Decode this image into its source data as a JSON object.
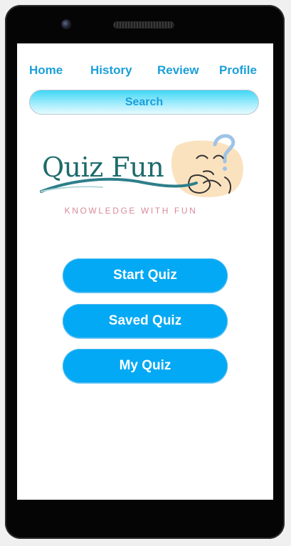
{
  "nav": {
    "items": [
      {
        "label": "Home"
      },
      {
        "label": "History"
      },
      {
        "label": "Review"
      },
      {
        "label": "Profile"
      }
    ]
  },
  "search": {
    "label": "Search"
  },
  "logo": {
    "title": "Quiz Fun",
    "tagline": "KNOWLEDGE WITH FUN"
  },
  "actions": {
    "start_quiz": "Start Quiz",
    "saved_quiz": "Saved Quiz",
    "my_quiz": "My Quiz"
  },
  "colors": {
    "accent": "#03a9f4",
    "nav_text": "#1b9fda",
    "logo_teal": "#1e6b6b",
    "tagline_pink": "#d98a9a",
    "phone_body": "#050505"
  },
  "icons": {
    "camera": "camera-icon",
    "speaker": "speaker-grille",
    "logo_face": "thinking-face-icon"
  }
}
